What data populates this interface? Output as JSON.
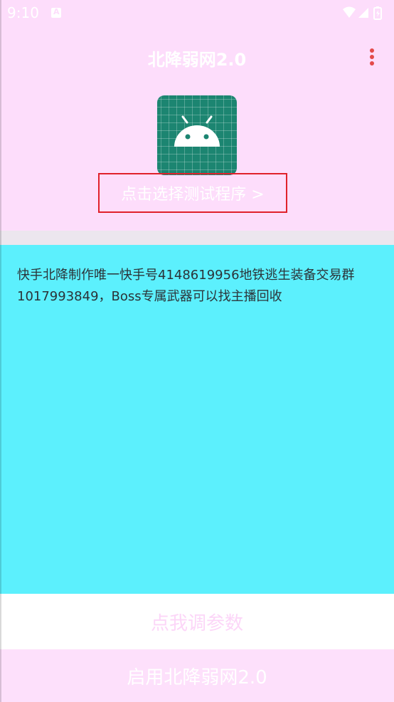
{
  "status_bar": {
    "time": "9:10",
    "icons": [
      "a-notification-icon",
      "wifi-icon",
      "signal-icon",
      "battery-icon"
    ]
  },
  "header": {
    "title": "北降弱网2.0",
    "menu_icon": "more-vertical-icon"
  },
  "app_picker": {
    "icon": "android-icon",
    "label": "点击选择测试程序 >"
  },
  "info": {
    "text": "快手北降制作唯一快手号4148619956地铁逃生装备交易群1017993849，Boss专属武器可以找主播回收"
  },
  "actions": {
    "params_label": "点我调参数",
    "enable_label": "启用北降弱网2.0"
  },
  "colors": {
    "header_bg": "#FDDDFB",
    "info_bg": "#5CF0FD",
    "highlight_border": "#E0212B",
    "menu_dots": "#E34A4A",
    "app_icon_bg": "#1C8571"
  }
}
